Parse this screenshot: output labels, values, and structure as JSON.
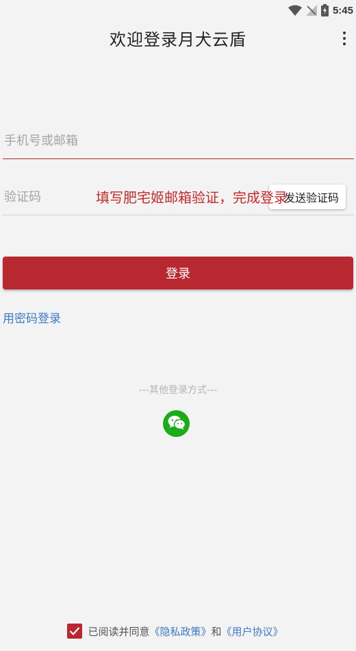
{
  "status_bar": {
    "time": "5:45",
    "icons": [
      "wifi-icon",
      "no-signal-icon",
      "battery-charging-icon"
    ]
  },
  "header": {
    "title": "欢迎登录月犬云盾",
    "menu_icon": "more-vertical-icon"
  },
  "form": {
    "phone_placeholder": "手机号或邮箱",
    "code_placeholder": "验证码",
    "send_code_label": "发送验证码",
    "hint_overlay": "填写肥宅姬邮箱验证，完成登录",
    "login_label": "登录",
    "password_login_label": "用密码登录"
  },
  "other_login": {
    "label": "---其他登录方式---",
    "wechat_icon": "wechat-icon"
  },
  "agreement": {
    "checked": true,
    "prefix": "已阅读并同意",
    "privacy_label": "《隐私政策》",
    "and": "和",
    "terms_label": "《用户协议》"
  },
  "colors": {
    "accent": "#b72830",
    "link": "#3d7bc8",
    "wechat": "#1aad19",
    "background": "#f3f3f3"
  }
}
